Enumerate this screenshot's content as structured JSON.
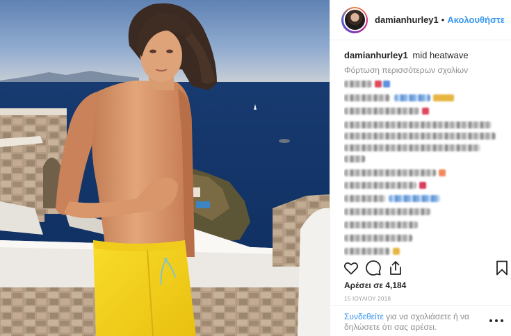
{
  "post": {
    "username": "damianhurley1",
    "separator": "•",
    "follow_label": "Ακολουθήστε",
    "caption_text": "mid heatwave",
    "load_more_label": "Φόρτωση περισσότερων σχολίων",
    "likes_text": "Αρέσει σε 4,184",
    "date_text": "15 ΙΟΥΛΙΟΥ 2018"
  },
  "icons": {
    "like": "heart-icon",
    "comment": "speech-bubble-icon",
    "share": "share-icon",
    "save": "bookmark-icon",
    "more": "ellipsis-icon"
  },
  "footer": {
    "login_link": "Συνδεθείτε",
    "login_text": " για να σχολιάσετε ή να δηλώσετε ότι σας αρέσει."
  },
  "colors": {
    "link_blue": "#3897f0",
    "text_dark": "#262626",
    "text_gray": "#8e8e8e",
    "swim_shorts_yellow": "#f7d51c"
  }
}
